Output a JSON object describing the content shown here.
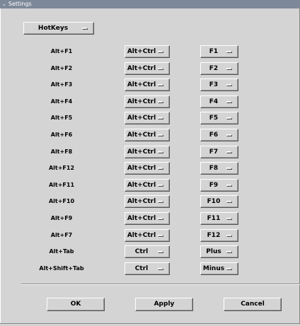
{
  "window": {
    "title": "Settings"
  },
  "category_select": {
    "value": "HotKeys"
  },
  "rows": [
    {
      "action": "Alt+F1",
      "modifier": "Alt+Ctrl",
      "key": "F1"
    },
    {
      "action": "Alt+F2",
      "modifier": "Alt+Ctrl",
      "key": "F2"
    },
    {
      "action": "Alt+F3",
      "modifier": "Alt+Ctrl",
      "key": "F3"
    },
    {
      "action": "Alt+F4",
      "modifier": "Alt+Ctrl",
      "key": "F4"
    },
    {
      "action": "Alt+F5",
      "modifier": "Alt+Ctrl",
      "key": "F5"
    },
    {
      "action": "Alt+F6",
      "modifier": "Alt+Ctrl",
      "key": "F6"
    },
    {
      "action": "Alt+F8",
      "modifier": "Alt+Ctrl",
      "key": "F7"
    },
    {
      "action": "Alt+F12",
      "modifier": "Alt+Ctrl",
      "key": "F8"
    },
    {
      "action": "Alt+F11",
      "modifier": "Alt+Ctrl",
      "key": "F9"
    },
    {
      "action": "Alt+F10",
      "modifier": "Alt+Ctrl",
      "key": "F10"
    },
    {
      "action": "Alt+F9",
      "modifier": "Alt+Ctrl",
      "key": "F11"
    },
    {
      "action": "Alt+F7",
      "modifier": "Alt+Ctrl",
      "key": "F12"
    },
    {
      "action": "Alt+Tab",
      "modifier": "Ctrl",
      "key": "Plus"
    },
    {
      "action": "Alt+Shift+Tab",
      "modifier": "Ctrl",
      "key": "Minus"
    }
  ],
  "buttons": {
    "ok": "OK",
    "apply": "Apply",
    "cancel": "Cancel"
  }
}
